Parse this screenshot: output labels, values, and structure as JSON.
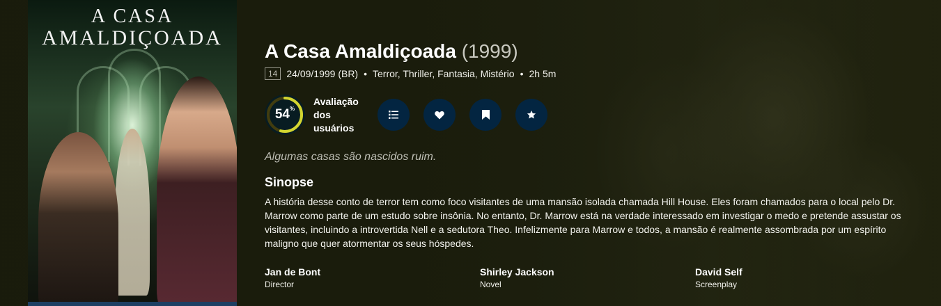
{
  "poster": {
    "title_line1": "A CASA",
    "title_line2": "AMALDIÇOADA"
  },
  "movie": {
    "title": "A Casa Amaldiçoada",
    "year": "(1999)",
    "certification": "14",
    "release": "24/09/1999 (BR)",
    "genres": "Terror, Thriller, Fantasia, Mistério",
    "runtime": "2h 5m",
    "separator": "•"
  },
  "score": {
    "value": "54",
    "unit": "%",
    "percent": 54,
    "label": "Avaliação dos usuários",
    "ring_color": "#d2d531",
    "track_color": "#423d0f"
  },
  "actions": [
    {
      "name": "add-to-list",
      "icon": "list-icon"
    },
    {
      "name": "favorite",
      "icon": "heart-icon"
    },
    {
      "name": "watchlist",
      "icon": "bookmark-icon"
    },
    {
      "name": "rate",
      "icon": "star-icon"
    }
  ],
  "tagline": "Algumas casas são nascidos ruim.",
  "overview_heading": "Sinopse",
  "overview": "A história desse conto de terror tem como foco visitantes de uma mansão isolada chamada Hill House. Eles foram chamados para o local pelo Dr. Marrow como parte de um estudo sobre insônia. No entanto, Dr. Marrow está na verdade interessado em investigar o medo e pretende assustar os visitantes, incluindo a introvertida Nell e a sedutora Theo. Infelizmente para Marrow e todos, a mansão é realmente assombrada por um espírito maligno que quer atormentar os seus hóspedes.",
  "crew": [
    {
      "name": "Jan de Bont",
      "job": "Director"
    },
    {
      "name": "Shirley Jackson",
      "job": "Novel"
    },
    {
      "name": "David Self",
      "job": "Screenplay"
    }
  ]
}
